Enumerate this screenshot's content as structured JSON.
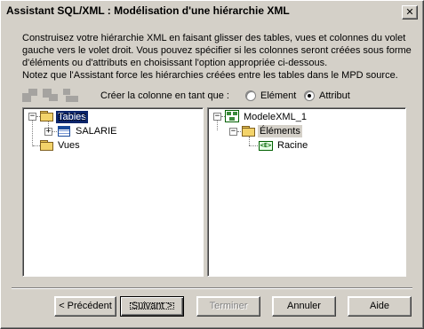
{
  "window": {
    "title": "Assistant SQL/XML : Modélisation d'une hiérarchie XML",
    "close_glyph": "✕"
  },
  "description": {
    "line1": "Construisez votre hiérarchie XML en faisant glisser des tables, vues et colonnes du volet",
    "line2": "gauche vers le volet droit. Vous pouvez spécifier si les colonnes seront créées sous forme",
    "line3": "d'éléments ou d'attributs en choisissant l'option appropriée ci-dessous.",
    "line4": "Notez que l'Assistant force les hiérarchies créées entre les tables dans le MPD source."
  },
  "options": {
    "create_label": "Créer la colonne en tant que :",
    "element_label": "Elément",
    "attribute_label": "Attribut",
    "selected": "attribute"
  },
  "left_tree": {
    "root_label": "Tables",
    "child_label": "SALARIE",
    "views_label": "Vues"
  },
  "right_tree": {
    "root_label": "ModeleXML_1",
    "elements_label": "Éléments",
    "racine_label": "Racine",
    "element_icon_text": "<E>"
  },
  "buttons": {
    "previous": "< Précédent",
    "next": "Suivant >",
    "finish": "Terminer",
    "cancel": "Annuler",
    "help": "Aide"
  },
  "colors": {
    "dialog_bg": "#d4d0c8",
    "selection": "#0a246a"
  }
}
